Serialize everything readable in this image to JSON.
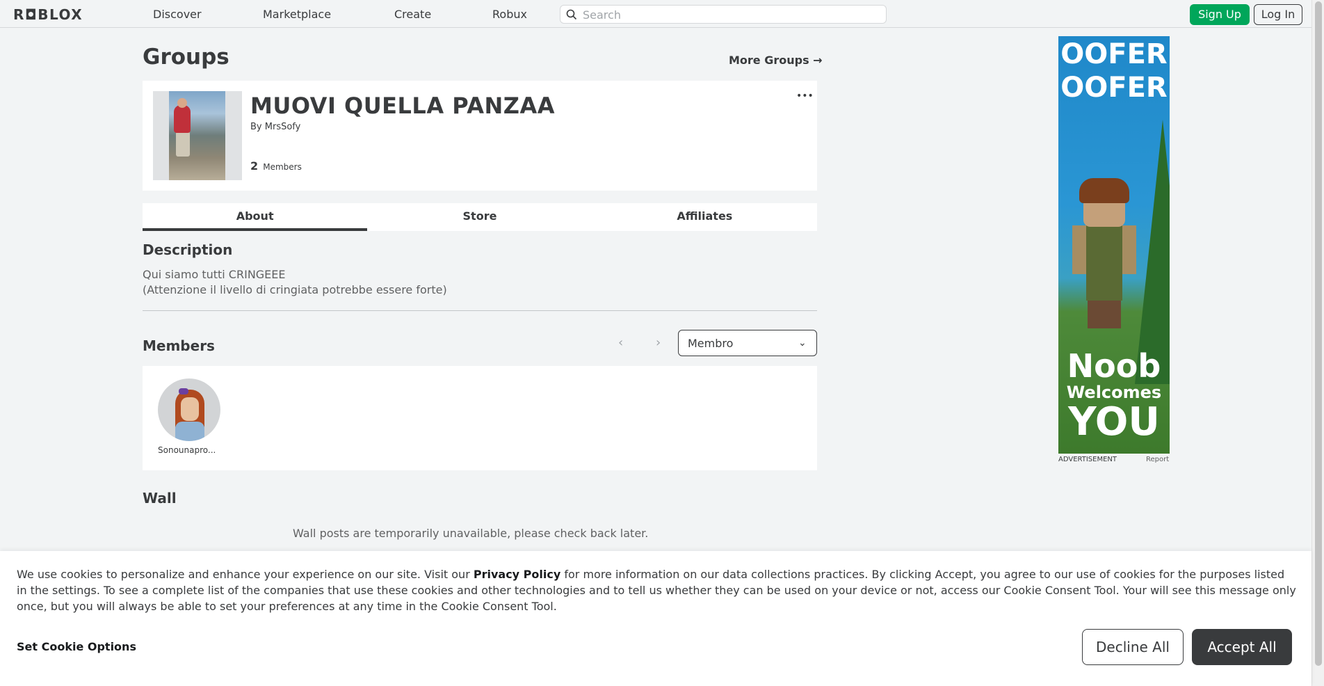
{
  "header": {
    "logo": "R◘BLOX",
    "nav": [
      "Discover",
      "Marketplace",
      "Create",
      "Robux"
    ],
    "search_placeholder": "Search",
    "sign_up": "Sign Up",
    "log_in": "Log In"
  },
  "page": {
    "title": "Groups",
    "more_groups": "More Groups →"
  },
  "group": {
    "name": "MUOVI QUELLA PANZAA",
    "by_label": "By",
    "owner": "MrsSofy",
    "member_count": "2",
    "members_label": "Members",
    "more_icon": "•••"
  },
  "tabs": [
    {
      "label": "About",
      "active": true
    },
    {
      "label": "Store",
      "active": false
    },
    {
      "label": "Affiliates",
      "active": false
    }
  ],
  "about": {
    "description_title": "Description",
    "description": "Qui siamo tutti CRINGEEE\n(Attenzione il livello di cringiata potrebbe essere forte)",
    "members_title": "Members",
    "role_selected": "Membro",
    "members": [
      {
        "name": "Sonounapro..."
      }
    ],
    "wall_title": "Wall",
    "wall_message": "Wall posts are temporarily unavailable, please check back later."
  },
  "ad": {
    "top_lines": [
      "OOFER",
      "OOFER"
    ],
    "bottom_line1": "Noob",
    "bottom_line2": "Welcomes",
    "bottom_line3": "YOU",
    "label": "ADVERTISEMENT",
    "report": "Report"
  },
  "cookie": {
    "text_before": "We use cookies to personalize and enhance your experience on our site. Visit our ",
    "privacy_policy": "Privacy Policy",
    "text_after": " for more information on our data collections practices. By clicking Accept, you agree to our use of cookies for the purposes listed in the settings. To see a complete list of the companies that use these cookies and other technologies and to tell us whether they can be used on your device or not, access our Cookie Consent Tool. Your will see this message only once, but you will always be able to set your preferences at any time in the Cookie Consent Tool.",
    "set_options": "Set Cookie Options",
    "decline": "Decline All",
    "accept": "Accept All"
  },
  "colors": {
    "accent_green": "#00a65a",
    "text_dark": "#393b3d",
    "page_bg": "#f2f4f5"
  }
}
